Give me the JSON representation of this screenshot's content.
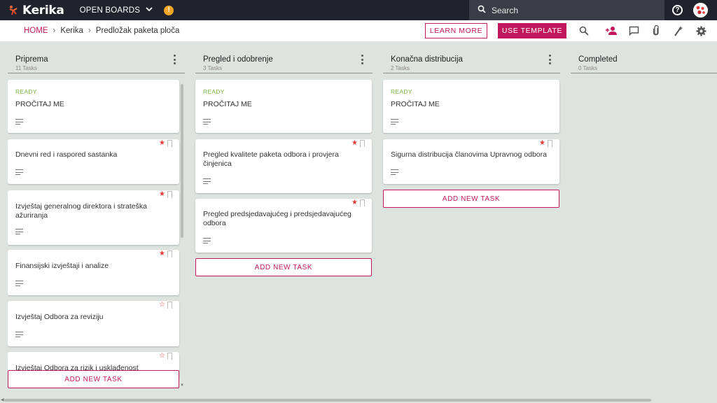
{
  "app": {
    "logo_text": "Kerika",
    "open_boards_label": "OPEN BOARDS",
    "alert_label": "!"
  },
  "search": {
    "placeholder": "Search"
  },
  "help": {
    "label": "?"
  },
  "breadcrumb": {
    "home": "HOME",
    "items": [
      "Kerika",
      "Predložak paketa ploča"
    ]
  },
  "actions": {
    "learn_more": "LEARN MORE",
    "use_template": "USE TEMPLATE"
  },
  "toolbar_icons": [
    "search-icon",
    "add-person-icon",
    "chat-icon",
    "attachment-icon",
    "magic-wand-icon",
    "settings-icon"
  ],
  "colors": {
    "accent": "#c2185b",
    "topbar": "#20232b",
    "board_bg": "#dde3df",
    "ready": "#7cb342",
    "star": "#e53935"
  },
  "columns": [
    {
      "title": "Priprema",
      "count": "11 Tasks",
      "cards": [
        {
          "status": "READY",
          "title": "PROČITAJ ME",
          "starred": false
        },
        {
          "status": "",
          "title": "Dnevni red i raspored sastanka",
          "starred": true
        },
        {
          "status": "",
          "title": "Izvještaj generalnog direktora i strateška ažuriranja",
          "starred": true
        },
        {
          "status": "",
          "title": "Finansijski izvještaji i analize",
          "starred": true
        },
        {
          "status": "",
          "title": "Izvještaj Odbora za reviziju",
          "starred": "outline"
        },
        {
          "status": "",
          "title": "Izvještaj Odbora za rizik i usklađenost",
          "starred": "outline"
        }
      ],
      "add_label": "ADD NEW TASK"
    },
    {
      "title": "Pregled i odobrenje",
      "count": "3 Tasks",
      "cards": [
        {
          "status": "READY",
          "title": "PROČITAJ ME",
          "starred": false
        },
        {
          "status": "",
          "title": "Pregled kvalitete paketa odbora i provjera činjenica",
          "starred": true
        },
        {
          "status": "",
          "title": "Pregled predsjedavajućeg i predsjedavajućeg odbora",
          "starred": true
        }
      ],
      "add_label": "ADD NEW TASK"
    },
    {
      "title": "Konačna distribucija",
      "count": "2 Tasks",
      "cards": [
        {
          "status": "READY",
          "title": "PROČITAJ ME",
          "starred": false
        },
        {
          "status": "",
          "title": "Sigurna distribucija članovima Upravnog odbora",
          "starred": true
        }
      ],
      "add_label": "ADD NEW TASK"
    },
    {
      "title": "Completed",
      "count": "0 Tasks",
      "cards": []
    }
  ]
}
